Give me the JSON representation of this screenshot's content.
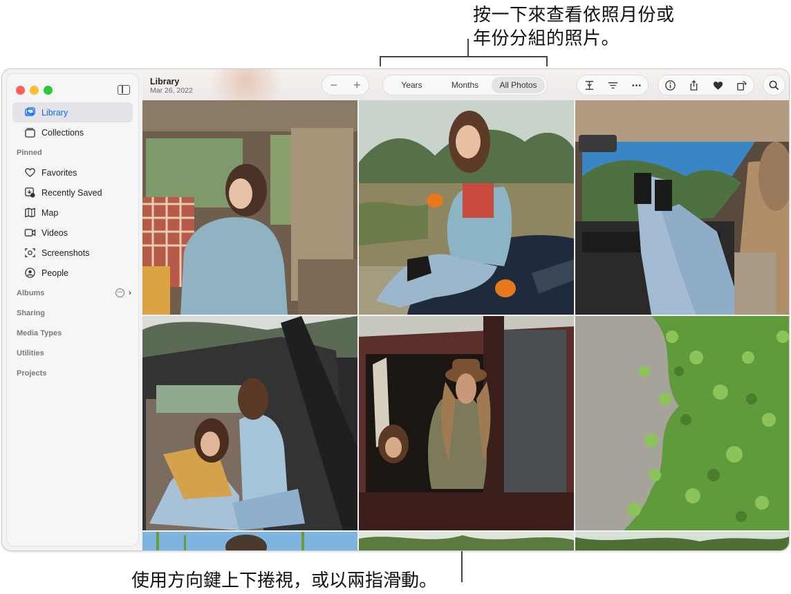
{
  "callouts": {
    "top_line1": "按一下來查看依照月份或",
    "top_line2": "年份分組的照片。",
    "bottom": "使用方向鍵上下捲視，或以兩指滑動。"
  },
  "sidebar": {
    "primary": [
      {
        "label": "Library",
        "icon": "photo-library-icon",
        "active": true
      },
      {
        "label": "Collections",
        "icon": "collections-icon",
        "active": false
      }
    ],
    "pinned_header": "Pinned",
    "pinned": [
      {
        "label": "Favorites",
        "icon": "heart-icon"
      },
      {
        "label": "Recently Saved",
        "icon": "recently-saved-icon"
      },
      {
        "label": "Map",
        "icon": "map-icon"
      },
      {
        "label": "Videos",
        "icon": "video-icon"
      },
      {
        "label": "Screenshots",
        "icon": "screenshot-icon"
      },
      {
        "label": "People",
        "icon": "people-icon"
      }
    ],
    "sections": [
      "Albums",
      "Sharing",
      "Media Types",
      "Utilities",
      "Projects"
    ]
  },
  "toolbar": {
    "title": "Library",
    "date": "Mar 26, 2022",
    "zoom_out": "−",
    "zoom_in": "+",
    "segments": [
      "Years",
      "Months",
      "All Photos"
    ],
    "active_segment": "All Photos"
  },
  "colors": {
    "accent": "#0a6cf0",
    "sidebar_bg": "#f6f6f7",
    "window_bg": "#f2f2f4"
  }
}
